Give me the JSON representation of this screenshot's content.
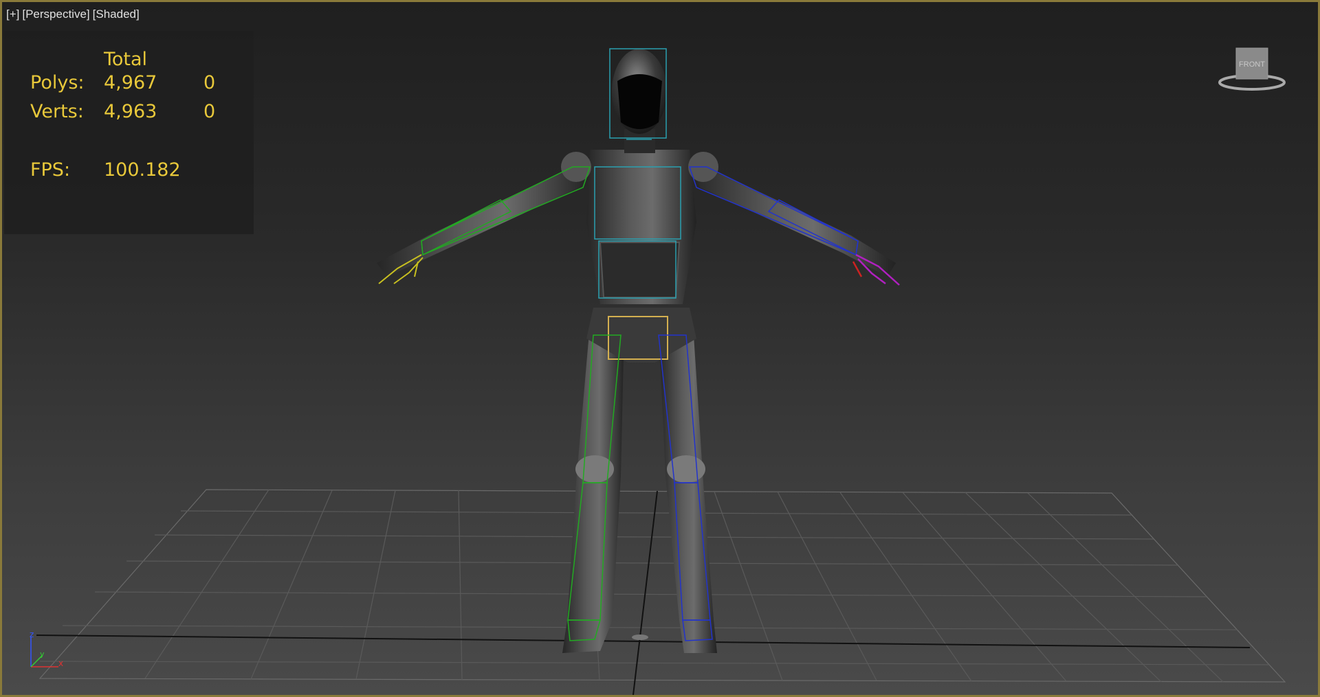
{
  "viewport": {
    "label_plus": "[+]",
    "label_view": "[Perspective]",
    "label_shading": "[Shaded]",
    "border_color": "#8a7a3a"
  },
  "stats": {
    "header_total": "Total",
    "polys_label": "Polys:",
    "polys_total": "4,967",
    "polys_selected": "0",
    "verts_label": "Verts:",
    "verts_total": "4,963",
    "verts_selected": "0",
    "fps_label": "FPS:",
    "fps_value": "100.182",
    "text_color": "#e8c83a"
  },
  "viewcube": {
    "face_label": "FRONT"
  },
  "axis_tripod": {
    "z_label": "z",
    "y_label": "y",
    "x_label": "x"
  },
  "colors": {
    "left_limb_bones": "#22aa22",
    "right_limb_bones": "#2233cc",
    "spine_bones": "#2aa0b0",
    "pelvis_bone": "#d4b050",
    "left_finger_bones": "#c8c020",
    "right_finger_bones": "#b020c0"
  }
}
